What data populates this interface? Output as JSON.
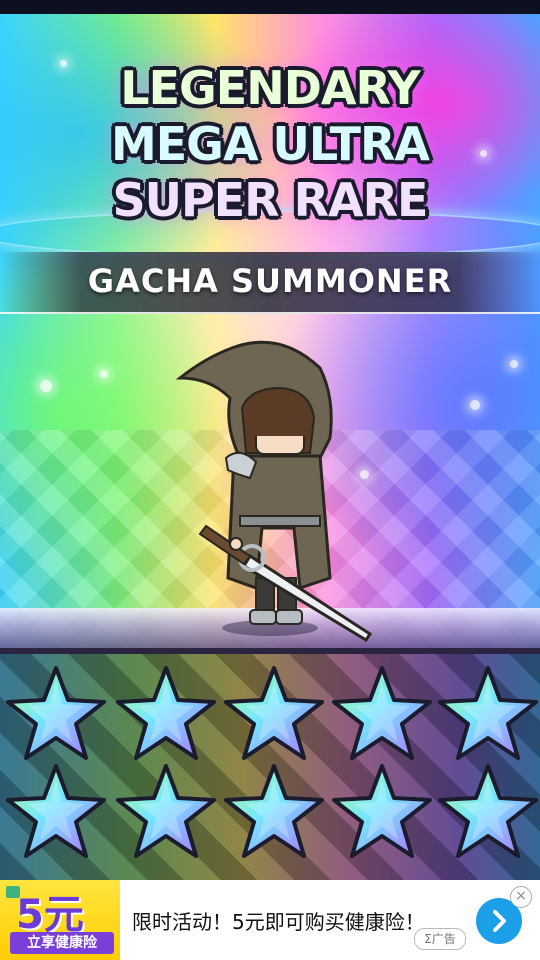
{
  "title": {
    "line1": "LEGENDARY",
    "line2": "MEGA ULTRA",
    "line3": "SUPER RARE"
  },
  "subtitle": "GACHA SUMMONER",
  "character": {
    "icon": "hooded-swordsman-character"
  },
  "rarity": {
    "stars_shown": 10,
    "icon": "rainbow-star-icon"
  },
  "ad": {
    "image_text": "5元",
    "image_subtext": "立享健康险",
    "text": "限时活动！5元即可购买健康险！",
    "badge": "Σ广告",
    "cta_icon": "chevron-right-icon",
    "close_icon": "close-icon",
    "colors": {
      "cta": "#1a9fe8",
      "image_bg": "#ffcc00",
      "image_strip": "#7a3fd8"
    }
  }
}
